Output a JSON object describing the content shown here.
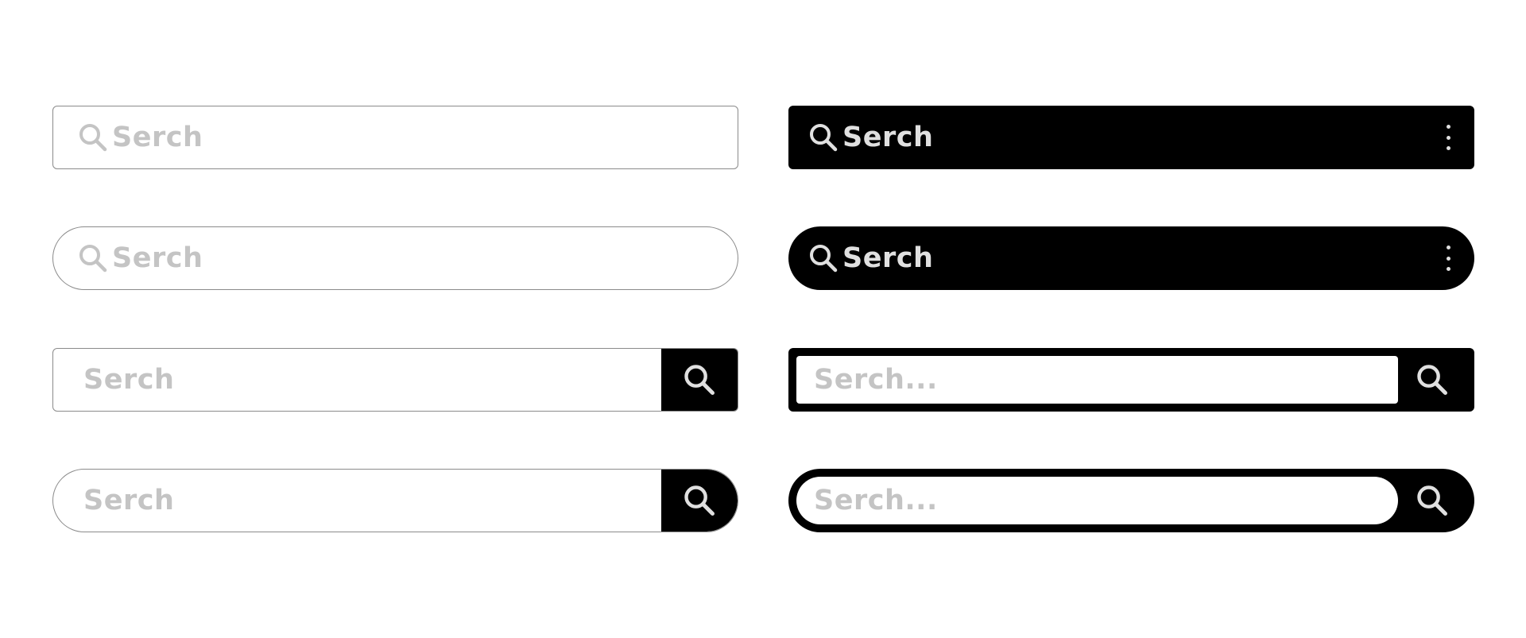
{
  "colors": {
    "dark": "#000000",
    "placeholder": "#c4c4c4",
    "dark_text": "#e0e0e0",
    "border": "#8a8a8a"
  },
  "bars": {
    "outline_square": {
      "placeholder": "Serch",
      "icon": "search-icon"
    },
    "outline_pill": {
      "placeholder": "Serch",
      "icon": "search-icon"
    },
    "outline_square_button": {
      "placeholder": "Serch",
      "button_icon": "search-icon"
    },
    "outline_pill_button": {
      "placeholder": "Serch",
      "button_icon": "search-icon"
    },
    "dark_square": {
      "placeholder": "Serch",
      "icon": "search-icon",
      "menu_icon": "kebab-menu-icon"
    },
    "dark_pill": {
      "placeholder": "Serch",
      "icon": "search-icon",
      "menu_icon": "kebab-menu-icon"
    },
    "framed_square": {
      "placeholder": "Serch...",
      "button_icon": "search-icon"
    },
    "framed_pill": {
      "placeholder": "Serch...",
      "button_icon": "search-icon"
    }
  }
}
